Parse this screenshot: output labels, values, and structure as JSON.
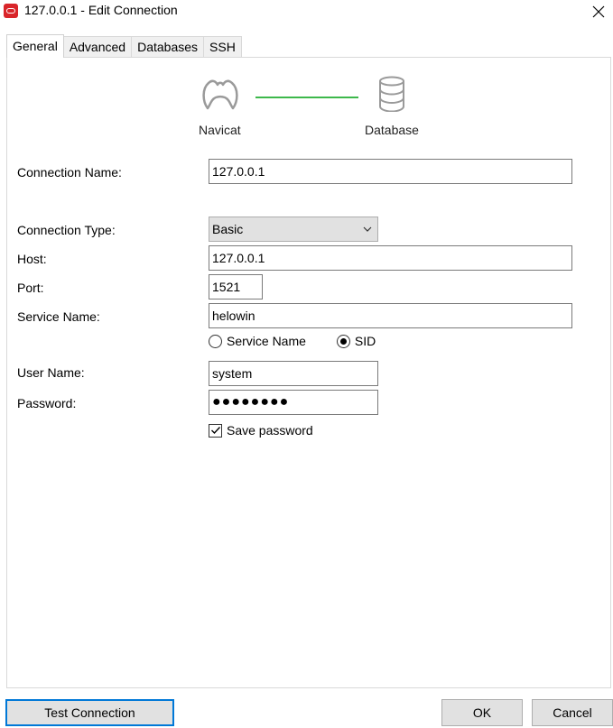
{
  "window": {
    "title": "127.0.0.1 - Edit Connection",
    "icon": "oracle-icon"
  },
  "tabs": [
    {
      "label": "General",
      "active": true
    },
    {
      "label": "Advanced",
      "active": false
    },
    {
      "label": "Databases",
      "active": false
    },
    {
      "label": "SSH",
      "active": false
    }
  ],
  "diagram": {
    "left_label": "Navicat",
    "right_label": "Database",
    "line_color": "#3db84b"
  },
  "form": {
    "connection_name": {
      "label": "Connection Name:",
      "value": "127.0.0.1"
    },
    "connection_type": {
      "label": "Connection Type:",
      "value": "Basic"
    },
    "host": {
      "label": "Host:",
      "value": "127.0.0.1"
    },
    "port": {
      "label": "Port:",
      "value": "1521"
    },
    "service_name": {
      "label": "Service Name:",
      "value": "helowin"
    },
    "service_mode": {
      "options": [
        "Service Name",
        "SID"
      ],
      "selected": "SID"
    },
    "user_name": {
      "label": "User Name:",
      "value": "system"
    },
    "password": {
      "label": "Password:",
      "masked": "●●●●●●●●"
    },
    "save_password": {
      "label": "Save password",
      "checked": true
    }
  },
  "buttons": {
    "test_connection": "Test Connection",
    "ok": "OK",
    "cancel": "Cancel"
  },
  "colors": {
    "focus_border": "#0078d7",
    "app_icon": "#d9252a"
  }
}
